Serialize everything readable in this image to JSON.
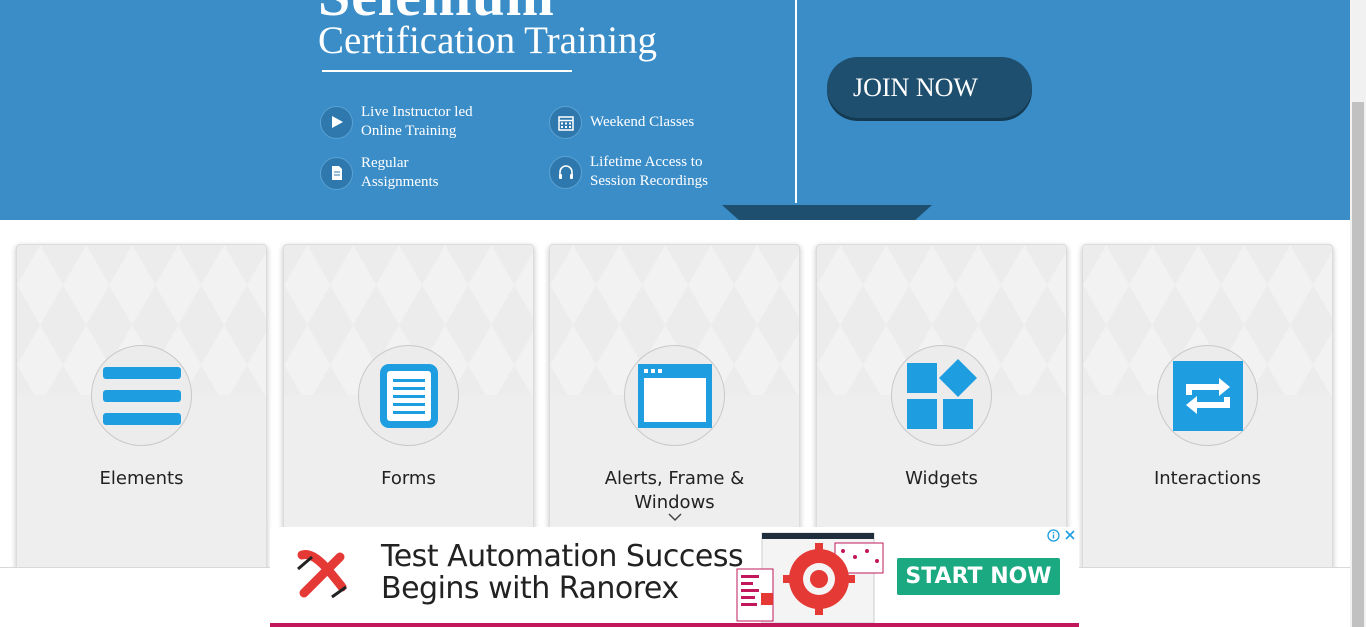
{
  "banner": {
    "title_top": "Selenium",
    "title": "Certification Training",
    "features": [
      {
        "icon": "play-icon",
        "lines": [
          "Live Instructor led",
          "Online Training"
        ]
      },
      {
        "icon": "calendar-icon",
        "lines": [
          "Weekend Classes"
        ]
      },
      {
        "icon": "document-icon",
        "lines": [
          "Regular",
          "Assignments"
        ]
      },
      {
        "icon": "headphones-icon",
        "lines": [
          "Lifetime Access to",
          "Session Recordings"
        ]
      }
    ],
    "join_label": "JOIN NOW"
  },
  "cards": [
    {
      "label": "Elements",
      "icon": "hamburger-list-icon"
    },
    {
      "label": "Forms",
      "icon": "form-document-icon"
    },
    {
      "label": "Alerts, Frame & Windows",
      "icon": "browser-window-icon"
    },
    {
      "label": "Widgets",
      "icon": "widgets-blocks-icon"
    },
    {
      "label": "Interactions",
      "icon": "swap-arrows-icon"
    }
  ],
  "ad": {
    "line1": "Test Automation Success",
    "line2": "Begins with Ranorex",
    "cta": "START NOW",
    "logo": "ranorex-logo-icon",
    "illustration": "gear-dashboard-illustration",
    "choices_icon": "ad-choices-icon",
    "close_icon": "close-icon"
  },
  "colors": {
    "banner": "#3b8dc8",
    "join_button": "#1f4f6e",
    "card_icon": "#1e9ee0",
    "ad_cta": "#1aa980",
    "ad_logo": "#e53935"
  }
}
